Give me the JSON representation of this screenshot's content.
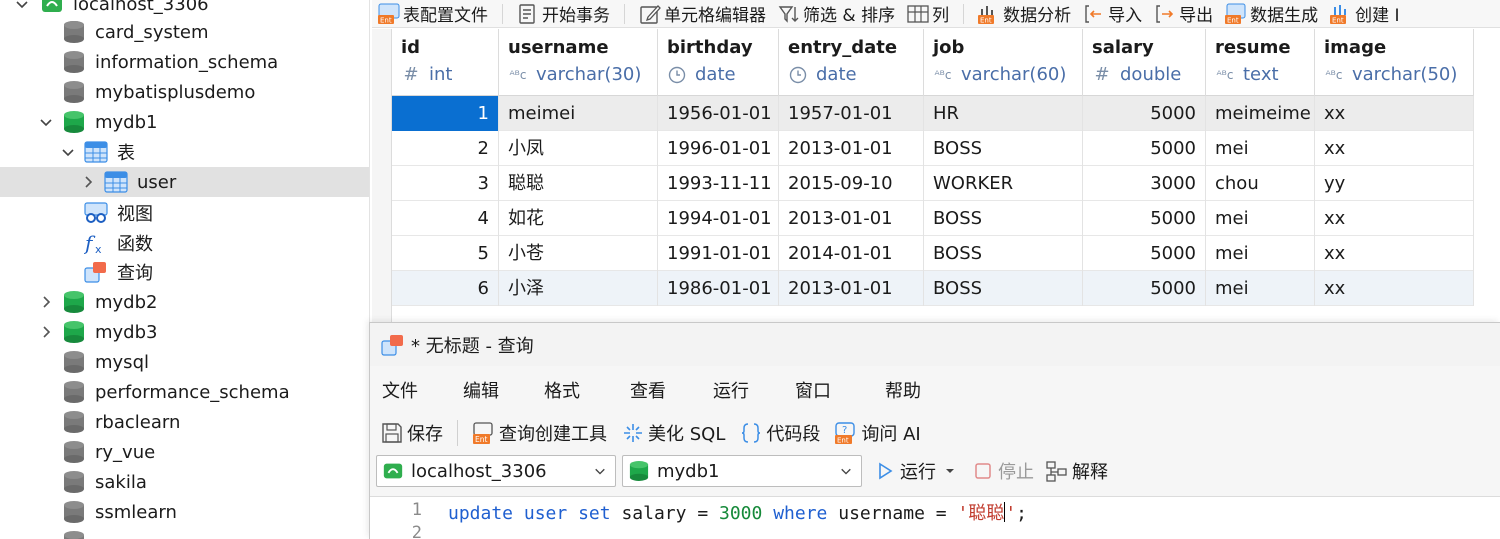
{
  "nav": {
    "connection": "localhost_3306",
    "databases_before": [
      "card_system",
      "information_schema",
      "mybatisplusdemo"
    ],
    "active_db": "mydb1",
    "tables_folder": "表",
    "selected_table": "user",
    "views_folder": "视图",
    "functions_folder": "函数",
    "queries_folder": "查询",
    "databases_after": [
      "mydb2",
      "mydb3",
      "mysql",
      "performance_schema",
      "rbaclearn",
      "ry_vue",
      "sakila",
      "ssmlearn"
    ]
  },
  "toolbar": {
    "items": [
      "表配置文件",
      "开始事务",
      "单元格编辑器",
      "筛选 & 排序",
      "列",
      "数据分析",
      "导入",
      "导出",
      "数据生成",
      "创建 I"
    ]
  },
  "grid": {
    "columns": [
      {
        "name": "id",
        "type": "int"
      },
      {
        "name": "username",
        "type": "varchar(30)"
      },
      {
        "name": "birthday",
        "type": "date"
      },
      {
        "name": "entry_date",
        "type": "date"
      },
      {
        "name": "job",
        "type": "varchar(60)"
      },
      {
        "name": "salary",
        "type": "double"
      },
      {
        "name": "resume",
        "type": "text"
      },
      {
        "name": "image",
        "type": "varchar(50)"
      }
    ],
    "rows": [
      [
        "1",
        "meimei",
        "1956-01-01",
        "1957-01-01",
        "HR",
        "5000",
        "meimeime",
        "xx"
      ],
      [
        "2",
        "小凤",
        "1996-01-01",
        "2013-01-01",
        "BOSS",
        "5000",
        "mei",
        "xx"
      ],
      [
        "3",
        "聪聪",
        "1993-11-11",
        "2015-09-10",
        "WORKER",
        "3000",
        "chou",
        "yy"
      ],
      [
        "4",
        "如花",
        "1994-01-01",
        "2013-01-01",
        "BOSS",
        "5000",
        "mei",
        "xx"
      ],
      [
        "5",
        "小苍",
        "1991-01-01",
        "2014-01-01",
        "BOSS",
        "5000",
        "mei",
        "xx"
      ],
      [
        "6",
        "小泽",
        "1986-01-01",
        "2013-01-01",
        "BOSS",
        "5000",
        "mei",
        "xx"
      ]
    ]
  },
  "query": {
    "title": "* 无标题 - 查询",
    "menu": [
      "文件",
      "编辑",
      "格式",
      "查看",
      "运行",
      "窗口",
      "帮助"
    ],
    "tools": {
      "save": "保存",
      "builder": "查询创建工具",
      "beautify": "美化 SQL",
      "snippet": "代码段",
      "ask_ai": "询问 AI"
    },
    "connection": "localhost_3306",
    "database": "mydb1",
    "run": "运行",
    "stop": "停止",
    "explain": "解释",
    "line1_no": "1",
    "line2_no": "2",
    "sql": {
      "kw_update": "update",
      "tbl": "user",
      "kw_set": "set",
      "col": "salary",
      "op1": "=",
      "val": "3000",
      "kw_where": "where",
      "col2": "username",
      "op2": "=",
      "str": "'聪聪",
      "str_end": "'",
      "semi": ";"
    }
  },
  "colors": {
    "accent": "#0a6fd1",
    "db_active": "#1ea84a",
    "db_inactive": "#7a7a7a",
    "keyword": "#1f5fd0",
    "number": "#168a3a",
    "string": "#c0392b"
  }
}
